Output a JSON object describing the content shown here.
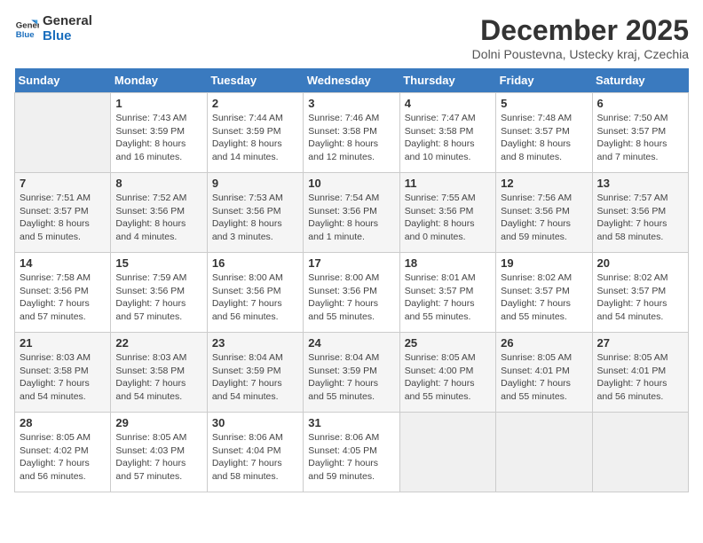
{
  "logo": {
    "line1": "General",
    "line2": "Blue"
  },
  "title": "December 2025",
  "subtitle": "Dolni Poustevna, Ustecky kraj, Czechia",
  "days_of_week": [
    "Sunday",
    "Monday",
    "Tuesday",
    "Wednesday",
    "Thursday",
    "Friday",
    "Saturday"
  ],
  "weeks": [
    [
      {
        "day": "",
        "info": ""
      },
      {
        "day": "1",
        "info": "Sunrise: 7:43 AM\nSunset: 3:59 PM\nDaylight: 8 hours\nand 16 minutes."
      },
      {
        "day": "2",
        "info": "Sunrise: 7:44 AM\nSunset: 3:59 PM\nDaylight: 8 hours\nand 14 minutes."
      },
      {
        "day": "3",
        "info": "Sunrise: 7:46 AM\nSunset: 3:58 PM\nDaylight: 8 hours\nand 12 minutes."
      },
      {
        "day": "4",
        "info": "Sunrise: 7:47 AM\nSunset: 3:58 PM\nDaylight: 8 hours\nand 10 minutes."
      },
      {
        "day": "5",
        "info": "Sunrise: 7:48 AM\nSunset: 3:57 PM\nDaylight: 8 hours\nand 8 minutes."
      },
      {
        "day": "6",
        "info": "Sunrise: 7:50 AM\nSunset: 3:57 PM\nDaylight: 8 hours\nand 7 minutes."
      }
    ],
    [
      {
        "day": "7",
        "info": "Sunrise: 7:51 AM\nSunset: 3:57 PM\nDaylight: 8 hours\nand 5 minutes."
      },
      {
        "day": "8",
        "info": "Sunrise: 7:52 AM\nSunset: 3:56 PM\nDaylight: 8 hours\nand 4 minutes."
      },
      {
        "day": "9",
        "info": "Sunrise: 7:53 AM\nSunset: 3:56 PM\nDaylight: 8 hours\nand 3 minutes."
      },
      {
        "day": "10",
        "info": "Sunrise: 7:54 AM\nSunset: 3:56 PM\nDaylight: 8 hours\nand 1 minute."
      },
      {
        "day": "11",
        "info": "Sunrise: 7:55 AM\nSunset: 3:56 PM\nDaylight: 8 hours\nand 0 minutes."
      },
      {
        "day": "12",
        "info": "Sunrise: 7:56 AM\nSunset: 3:56 PM\nDaylight: 7 hours\nand 59 minutes."
      },
      {
        "day": "13",
        "info": "Sunrise: 7:57 AM\nSunset: 3:56 PM\nDaylight: 7 hours\nand 58 minutes."
      }
    ],
    [
      {
        "day": "14",
        "info": "Sunrise: 7:58 AM\nSunset: 3:56 PM\nDaylight: 7 hours\nand 57 minutes."
      },
      {
        "day": "15",
        "info": "Sunrise: 7:59 AM\nSunset: 3:56 PM\nDaylight: 7 hours\nand 57 minutes."
      },
      {
        "day": "16",
        "info": "Sunrise: 8:00 AM\nSunset: 3:56 PM\nDaylight: 7 hours\nand 56 minutes."
      },
      {
        "day": "17",
        "info": "Sunrise: 8:00 AM\nSunset: 3:56 PM\nDaylight: 7 hours\nand 55 minutes."
      },
      {
        "day": "18",
        "info": "Sunrise: 8:01 AM\nSunset: 3:57 PM\nDaylight: 7 hours\nand 55 minutes."
      },
      {
        "day": "19",
        "info": "Sunrise: 8:02 AM\nSunset: 3:57 PM\nDaylight: 7 hours\nand 55 minutes."
      },
      {
        "day": "20",
        "info": "Sunrise: 8:02 AM\nSunset: 3:57 PM\nDaylight: 7 hours\nand 54 minutes."
      }
    ],
    [
      {
        "day": "21",
        "info": "Sunrise: 8:03 AM\nSunset: 3:58 PM\nDaylight: 7 hours\nand 54 minutes."
      },
      {
        "day": "22",
        "info": "Sunrise: 8:03 AM\nSunset: 3:58 PM\nDaylight: 7 hours\nand 54 minutes."
      },
      {
        "day": "23",
        "info": "Sunrise: 8:04 AM\nSunset: 3:59 PM\nDaylight: 7 hours\nand 54 minutes."
      },
      {
        "day": "24",
        "info": "Sunrise: 8:04 AM\nSunset: 3:59 PM\nDaylight: 7 hours\nand 55 minutes."
      },
      {
        "day": "25",
        "info": "Sunrise: 8:05 AM\nSunset: 4:00 PM\nDaylight: 7 hours\nand 55 minutes."
      },
      {
        "day": "26",
        "info": "Sunrise: 8:05 AM\nSunset: 4:01 PM\nDaylight: 7 hours\nand 55 minutes."
      },
      {
        "day": "27",
        "info": "Sunrise: 8:05 AM\nSunset: 4:01 PM\nDaylight: 7 hours\nand 56 minutes."
      }
    ],
    [
      {
        "day": "28",
        "info": "Sunrise: 8:05 AM\nSunset: 4:02 PM\nDaylight: 7 hours\nand 56 minutes."
      },
      {
        "day": "29",
        "info": "Sunrise: 8:05 AM\nSunset: 4:03 PM\nDaylight: 7 hours\nand 57 minutes."
      },
      {
        "day": "30",
        "info": "Sunrise: 8:06 AM\nSunset: 4:04 PM\nDaylight: 7 hours\nand 58 minutes."
      },
      {
        "day": "31",
        "info": "Sunrise: 8:06 AM\nSunset: 4:05 PM\nDaylight: 7 hours\nand 59 minutes."
      },
      {
        "day": "",
        "info": ""
      },
      {
        "day": "",
        "info": ""
      },
      {
        "day": "",
        "info": ""
      }
    ]
  ]
}
